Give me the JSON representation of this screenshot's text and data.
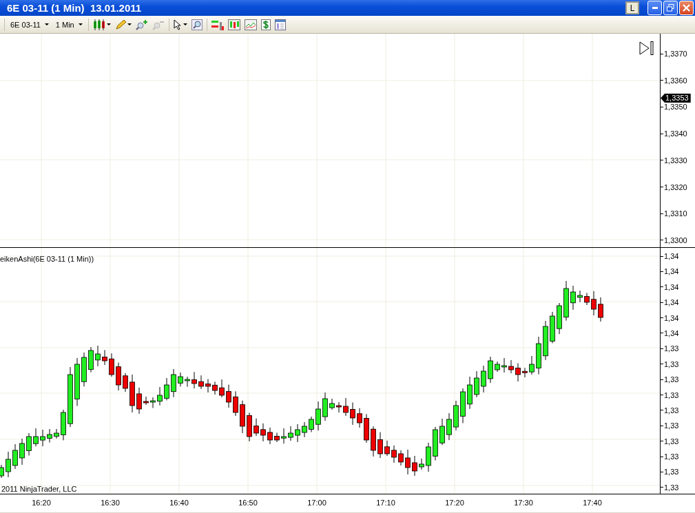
{
  "window": {
    "title": "6E 03-11 (1 Min)  13.01.2011",
    "buttons": [
      "L"
    ]
  },
  "toolbar": {
    "instrument": "6E 03-11",
    "interval": "1 Min"
  },
  "price_panel": {
    "y_axis": [
      "1,3370",
      "1,3360",
      "1,3350",
      "1,3340",
      "1,3330",
      "1,3320",
      "1,3310",
      "1,3300"
    ],
    "last_price": "1,3353"
  },
  "indicator_panel": {
    "label": "eikenAshi(6E 03-11 (1 Min))",
    "copyright": "2011 NinjaTrader, LLC",
    "y_axis": [
      "1,34",
      "1,34",
      "1,34",
      "1,34",
      "1,34",
      "1,34",
      "1,33",
      "1,33",
      "1,33",
      "1,33",
      "1,33",
      "1,33",
      "1,33",
      "1,33",
      "1,33",
      "1,33"
    ]
  },
  "x_axis": [
    "16:20",
    "16:30",
    "16:40",
    "16:50",
    "17:00",
    "17:10",
    "17:20",
    "17:30",
    "17:40"
  ]
}
